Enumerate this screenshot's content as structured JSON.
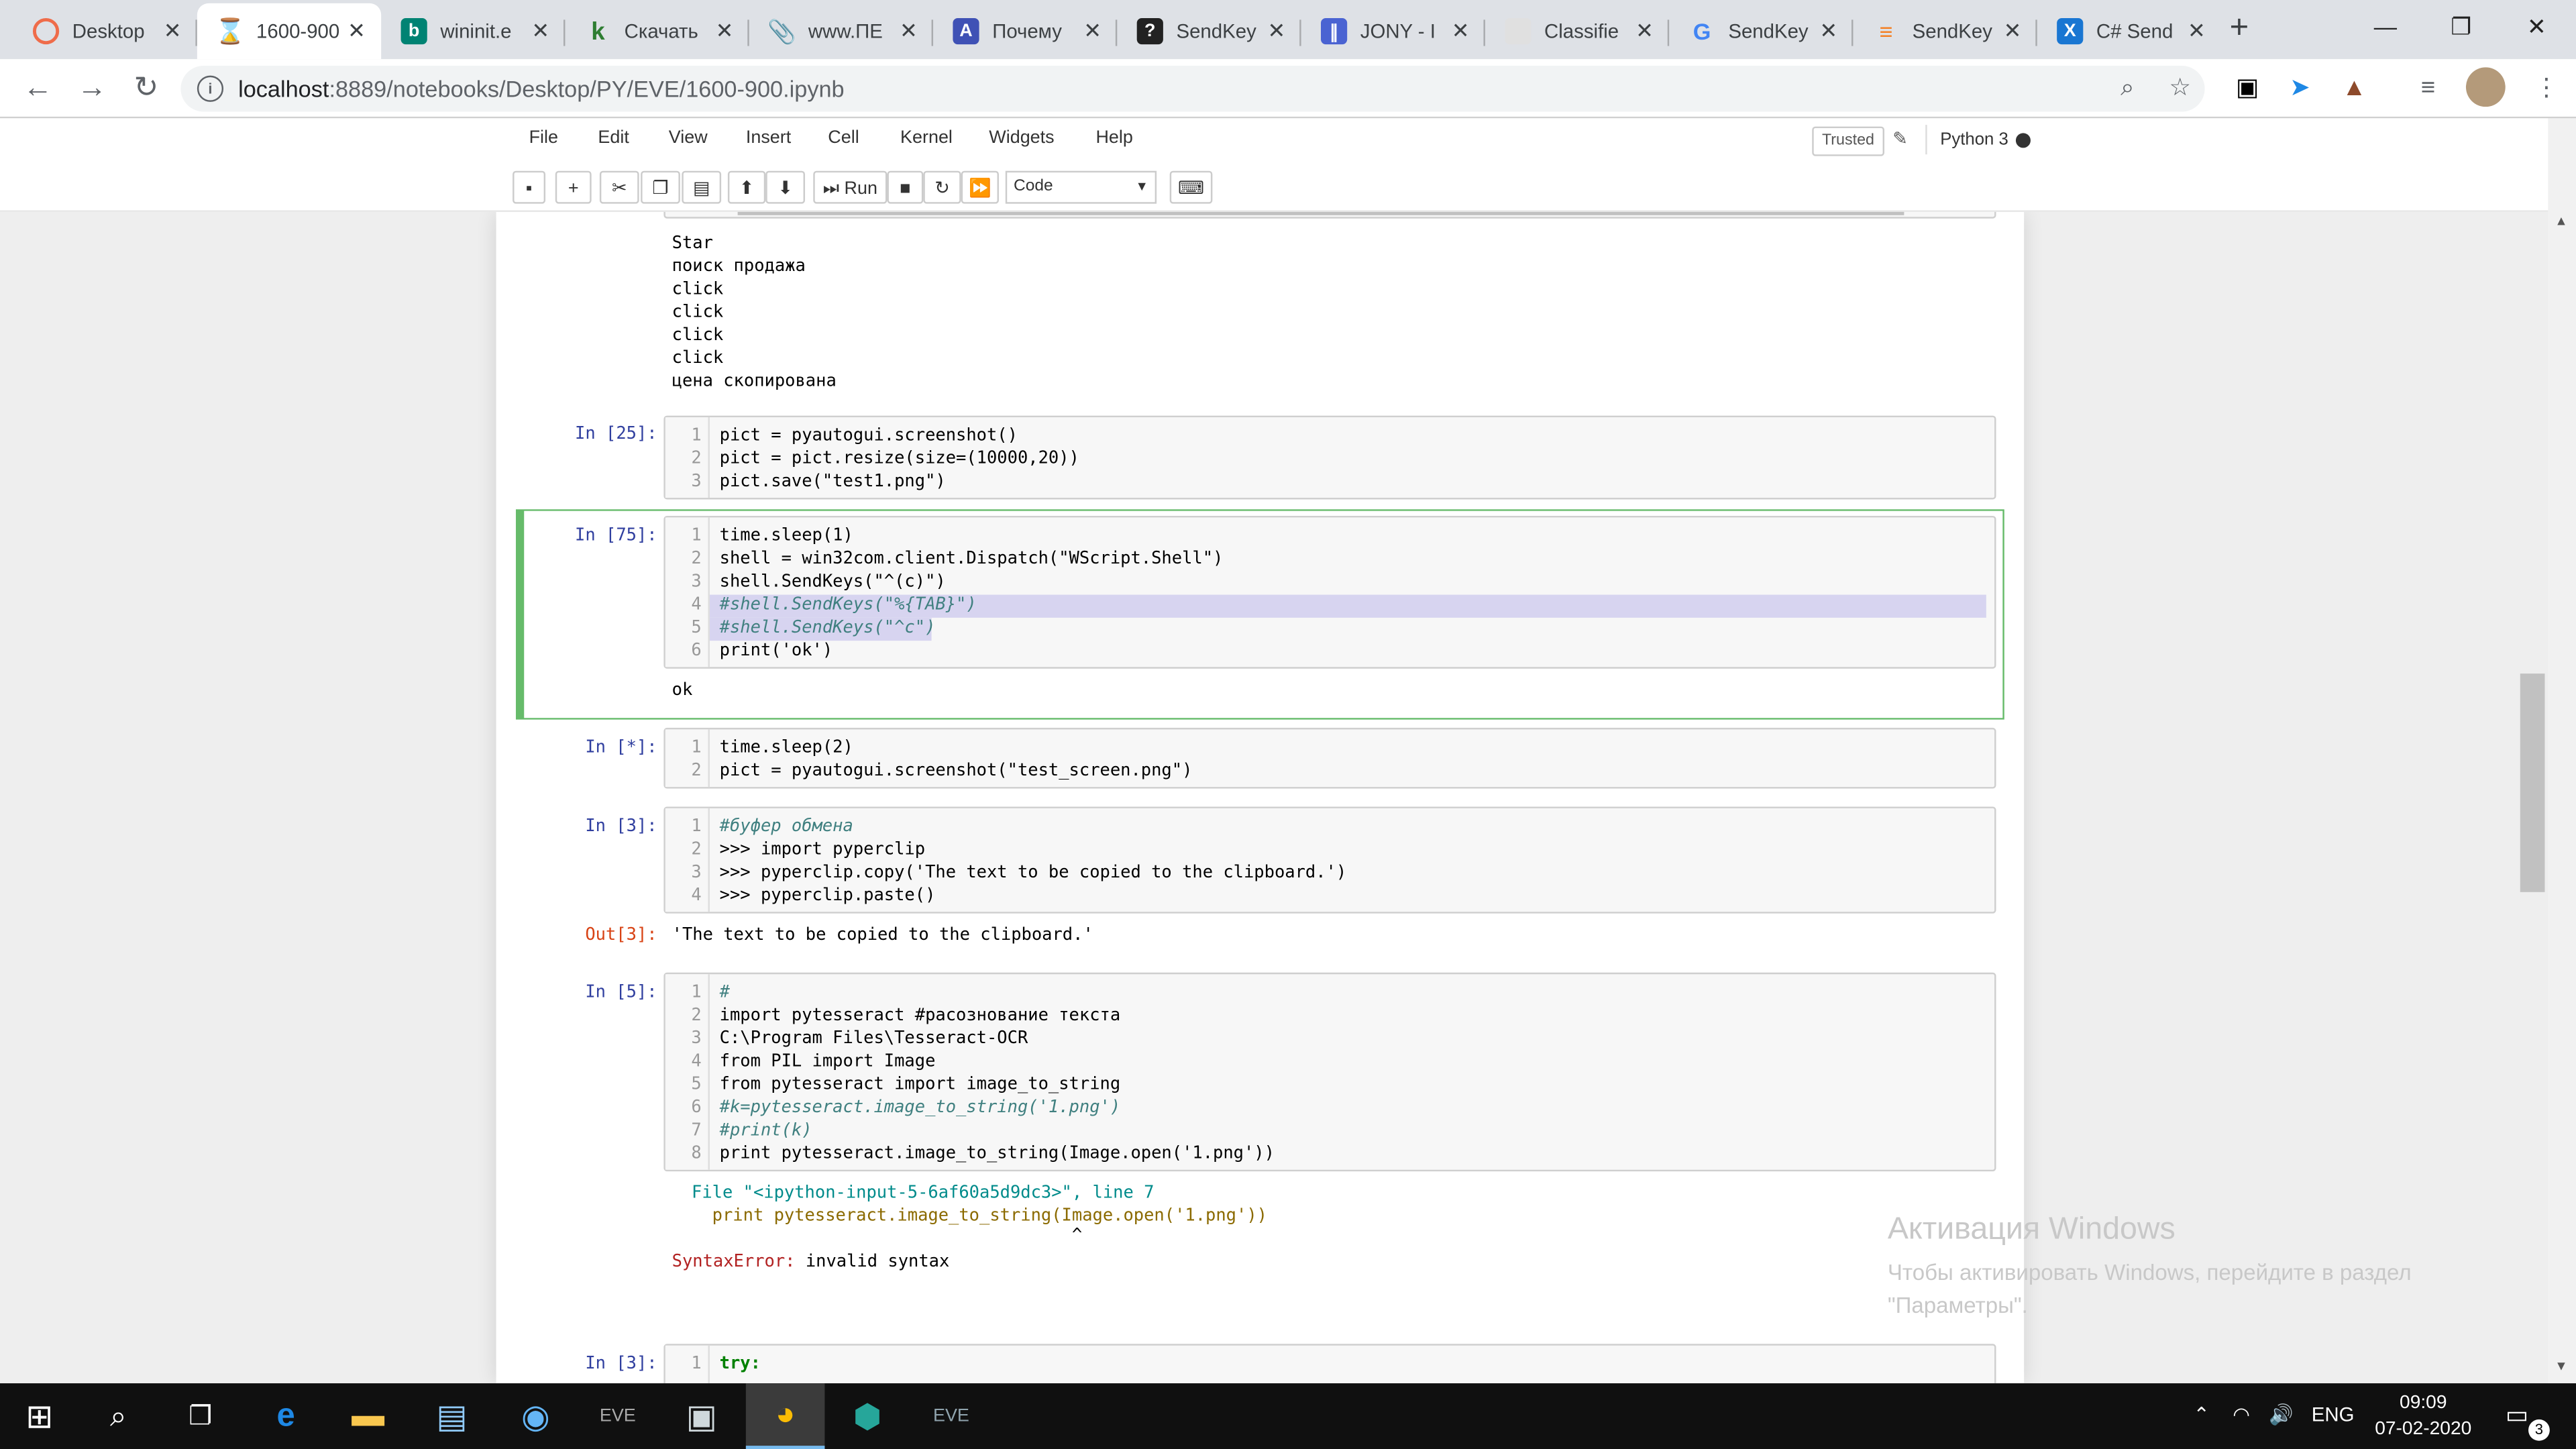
{
  "browser": {
    "tabs": [
      {
        "title": "Desktop",
        "icon": "chrome-icon",
        "color": "#ef6c4a"
      },
      {
        "title": "1600-900",
        "icon": "jupyter-hourglass-icon",
        "color": "#f57c00"
      },
      {
        "title": "wininit.e",
        "icon": "bing-icon",
        "color": "#008373"
      },
      {
        "title": "Скачать",
        "icon": "k-icon",
        "color": "#2e7d32"
      },
      {
        "title": "www.ПЕ",
        "icon": "paperclip-icon",
        "color": "#455a64"
      },
      {
        "title": "Почему",
        "icon": "translate-icon",
        "color": "#3f51b5"
      },
      {
        "title": "SendKey",
        "icon": "question-icon",
        "color": "#222222"
      },
      {
        "title": "JONY - I",
        "icon": "bars-icon",
        "color": "#4a63d2"
      },
      {
        "title": "Classifie",
        "icon": "cube-icon",
        "color": "#bdbdbd"
      },
      {
        "title": "SendKey",
        "icon": "google-icon",
        "color": "#4285f4"
      },
      {
        "title": "SendKey",
        "icon": "stackoverflow-icon",
        "color": "#f48024"
      },
      {
        "title": "C# Send",
        "icon": "x-icon",
        "color": "#1976d2"
      }
    ],
    "active_tab": 1,
    "url_host": "localhost",
    "url_path": ":8889/notebooks/Desktop/PY/EVE/1600-900.ipynb"
  },
  "jupyter": {
    "menu": [
      "File",
      "Edit",
      "View",
      "Insert",
      "Cell",
      "Kernel",
      "Widgets",
      "Help"
    ],
    "trusted": "Trusted",
    "kernel": "Python 3",
    "run_label": "Run",
    "cell_type": "Code"
  },
  "cells": {
    "c0_output": [
      "Star",
      "поиск продажа",
      "click",
      "click",
      "click",
      "click",
      "цена скопирована"
    ],
    "c1_prompt": "In [25]:",
    "c1_lines": [
      "pict = pyautogui.screenshot()",
      "pict = pict.resize(size=(10000,20))",
      "pict.save(\"test1.png\")"
    ],
    "c2_prompt": "In [75]:",
    "c2_lines": [
      "time.sleep(1)",
      "shell = win32com.client.Dispatch(\"WScript.Shell\")",
      "shell.SendKeys(\"^(c)\")",
      "#shell.SendKeys(\"%{TAB}\")",
      "#shell.SendKeys(\"^c\")",
      "print('ok')"
    ],
    "c2_output": "ok",
    "c3_prompt": "In [*]:",
    "c3_lines": [
      "time.sleep(2)",
      "pict = pyautogui.screenshot(\"test_screen.png\")"
    ],
    "c4_prompt": "In [3]:",
    "c4_lines": [
      "#буфер обмена",
      ">>> import pyperclip",
      ">>> pyperclip.copy('The text to be copied to the clipboard.')",
      ">>> pyperclip.paste()"
    ],
    "c4_out_prompt": "Out[3]:",
    "c4_output": "'The text to be copied to the clipboard.'",
    "c5_prompt": "In [5]:",
    "c5_lines": [
      "#",
      "import pytesseract #расознование текста",
      "C:\\Program Files\\Tesseract-OCR",
      "from PIL import Image",
      "from pytesseract import image_to_string",
      "#k=pytesseract.image_to_string('1.png')",
      "#print(k)",
      "print pytesseract.image_to_string(Image.open('1.png'))"
    ],
    "c5_tb_file": "File \"<ipython-input-5-6af60a5d9dc3>\", line 7",
    "c5_tb_code": "  print pytesseract.image_to_string(Image.open('1.png'))",
    "c5_tb_caret": "                                     ^",
    "c5_tb_err_name": "SyntaxError:",
    "c5_tb_err_msg": " invalid syntax",
    "c6_prompt": "In [3]:",
    "c6_line1": "try:"
  },
  "watermark": {
    "title": "Активация Windows",
    "text": "Чтобы активировать Windows, перейдите в раздел \"Параметры\"."
  },
  "taskbar": {
    "lang": "ENG",
    "time": "09:09",
    "date": "07-02-2020",
    "notifications": "3"
  }
}
